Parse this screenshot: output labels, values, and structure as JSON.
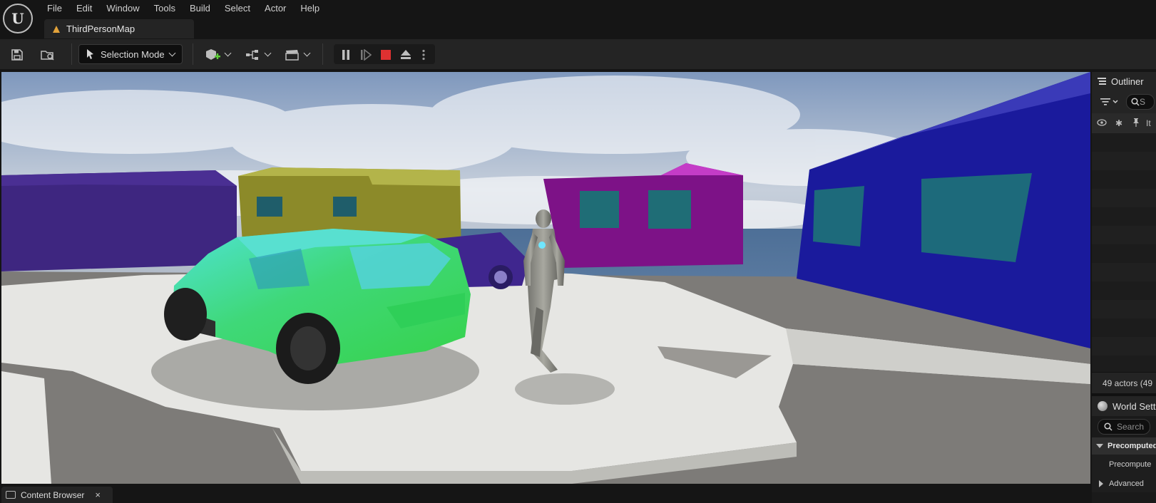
{
  "menu": {
    "items": [
      "File",
      "Edit",
      "Window",
      "Tools",
      "Build",
      "Select",
      "Actor",
      "Help"
    ],
    "logo": "unreal-logo-icon"
  },
  "document_tab": {
    "label": "ThirdPersonMap",
    "icon": "level-icon"
  },
  "toolbar": {
    "save_icon": "save-icon",
    "browse_icon": "browse-level-icon",
    "mode_label": "Selection Mode",
    "add_icon": "add-actor-icon",
    "blueprint_icon": "blueprint-icon",
    "cinematics_icon": "clapperboard-icon",
    "pause_icon": "pause-icon",
    "frame_skip_icon": "frame-skip-icon",
    "stop_icon": "stop-icon",
    "eject_icon": "eject-icon",
    "more_icon": "more-options-icon",
    "stop_color": "#e03131"
  },
  "outliner": {
    "title": "Outliner",
    "search_placeholder": "S",
    "columns_label": "It",
    "status": "49 actors (49"
  },
  "world_settings": {
    "title": "World Sett",
    "search_placeholder": "Search",
    "category": "Precomputed",
    "property": "Precompute",
    "advanced": "Advanced"
  },
  "bottom": {
    "content_browser_label": "Content Browser",
    "close_glyph": "×"
  }
}
